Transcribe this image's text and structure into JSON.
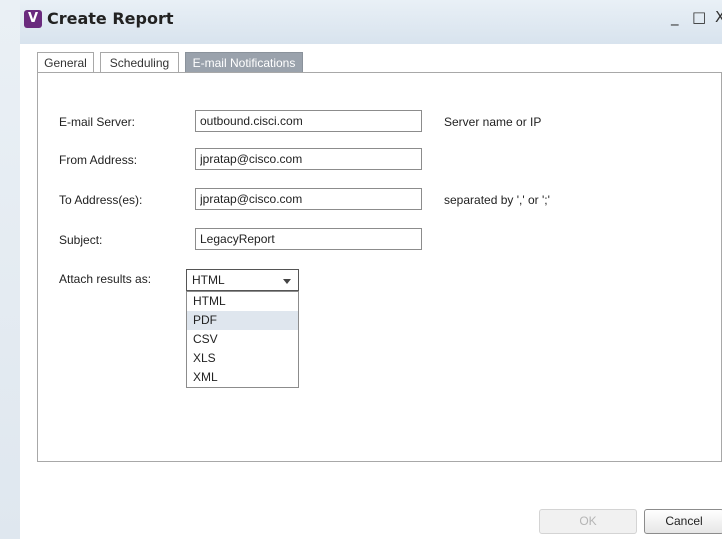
{
  "window": {
    "icon_letter": "V",
    "title": "Create Report",
    "controls": {
      "minimize": "_",
      "maximize": "□",
      "close": "X"
    }
  },
  "tabs": [
    {
      "label": "General",
      "active": false
    },
    {
      "label": "Scheduling",
      "active": false
    },
    {
      "label": "E-mail Notifications",
      "active": true
    }
  ],
  "form": {
    "email_server": {
      "label": "E-mail Server:",
      "value": "outbound.cisci.com",
      "hint": "Server name or IP"
    },
    "from_address": {
      "label": "From Address:",
      "value": "jpratap@cisco.com"
    },
    "to_address": {
      "label": "To Address(es):",
      "value": "jpratap@cisco.com",
      "hint": "separated by ',' or ';'"
    },
    "subject": {
      "label": "Subject:",
      "value": "LegacyReport"
    },
    "attach": {
      "label": "Attach results as:",
      "selected": "HTML",
      "options": [
        "HTML",
        "PDF",
        "CSV",
        "XLS",
        "XML"
      ],
      "hovered": "PDF"
    }
  },
  "buttons": {
    "ok": "OK",
    "cancel": "Cancel"
  },
  "colors": {
    "active_tab": "#9aa2ac",
    "brand_icon": "#6a2a7e",
    "hover_option": "#dfe6ee"
  }
}
